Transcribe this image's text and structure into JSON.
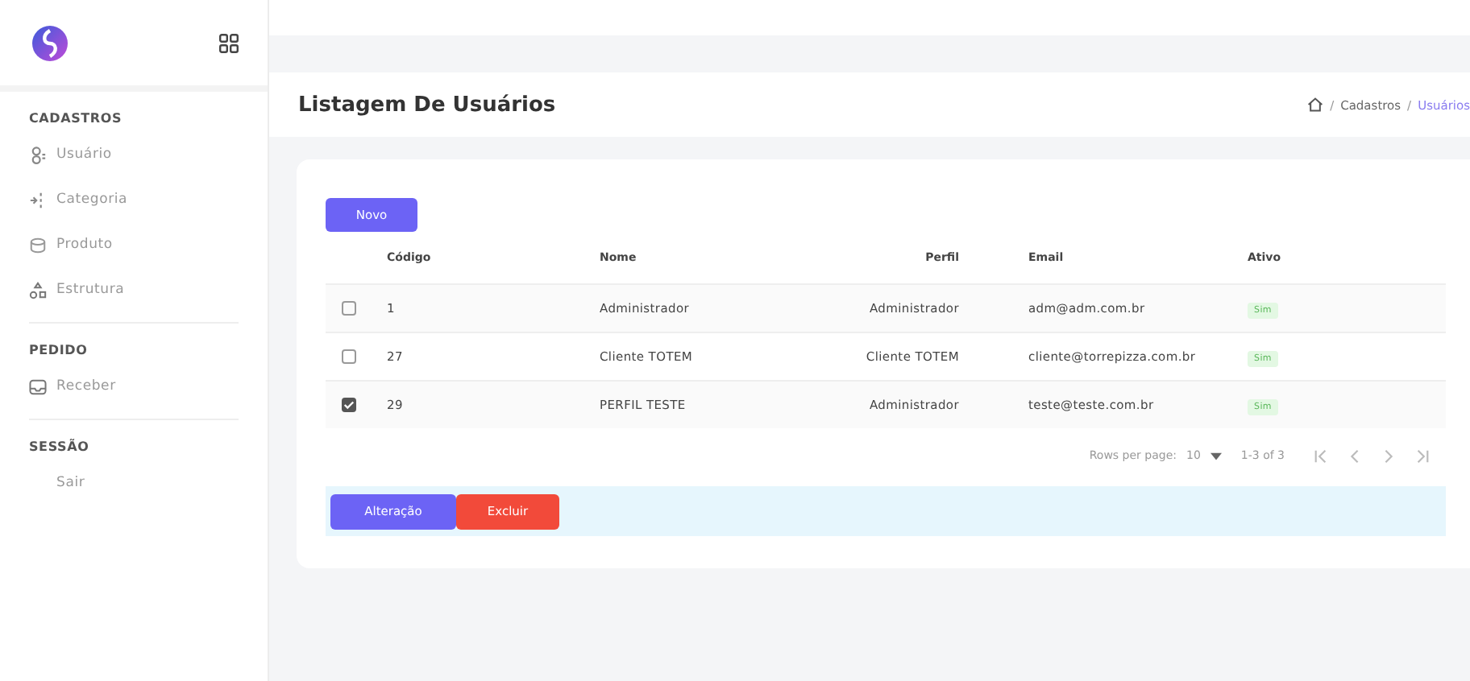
{
  "sidebar": {
    "sections": [
      {
        "title": "CADASTROS",
        "items": [
          {
            "label": "Usuário",
            "kind": "user"
          },
          {
            "label": "Categoria",
            "kind": "tree"
          },
          {
            "label": "Produto",
            "kind": "box"
          },
          {
            "label": "Estrutura",
            "kind": "shapes"
          }
        ]
      },
      {
        "title": "PEDIDO",
        "items": [
          {
            "label": "Receber",
            "kind": "inbox"
          }
        ]
      },
      {
        "title": "SESSÃO",
        "items": [
          {
            "label": "Sair",
            "kind": "plain"
          }
        ]
      }
    ]
  },
  "page": {
    "title": "Listagem De Usuários",
    "breadcrumb": [
      {
        "separator": "/",
        "label": "Cadastros"
      },
      {
        "separator": "/",
        "label": "Usuários"
      }
    ]
  },
  "new_button": "Novo",
  "table": {
    "columns": [
      "Código",
      "Nome",
      "Perfil",
      "Email",
      "Ativo"
    ],
    "rows": [
      {
        "selected": false,
        "cells": [
          "1",
          "Administrador",
          "Administrador",
          "adm@adm.com.br"
        ],
        "status": "Sim"
      },
      {
        "selected": false,
        "cells": [
          "27",
          "Cliente TOTEM",
          "Cliente TOTEM",
          "cliente@torrepizza.com.br"
        ],
        "status": "Sim"
      },
      {
        "selected": true,
        "cells": [
          "29",
          "PERFIL TESTE",
          "Administrador",
          "teste@teste.com.br"
        ],
        "status": "Sim"
      }
    ]
  },
  "pagination": {
    "label": "Rows per page:",
    "per_page": "10",
    "range": "1-3 of 3"
  },
  "actions": [
    "Alteração",
    "Excluir"
  ]
}
